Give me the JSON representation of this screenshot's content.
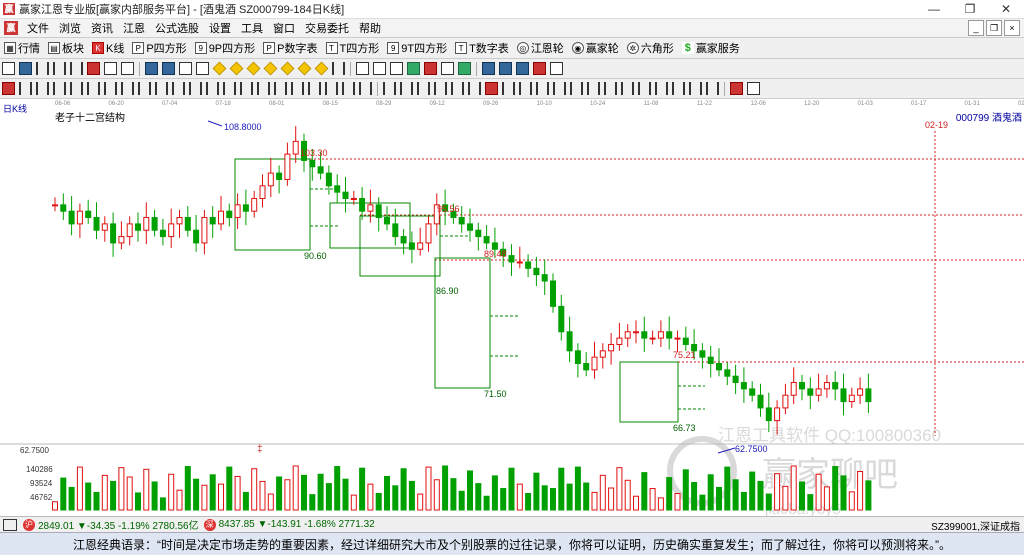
{
  "window": {
    "title": "赢家江恩专业版[赢家内部服务平台] - [酒鬼酒  SZ000799-184日K线]",
    "controls": [
      "—",
      "❐",
      "✕"
    ]
  },
  "menubar": {
    "items": [
      "文件",
      "浏览",
      "资讯",
      "江恩",
      "公式选股",
      "设置",
      "工具",
      "窗口",
      "交易委托",
      "帮助"
    ],
    "mdi_controls": [
      "_",
      "❐",
      "×"
    ]
  },
  "toolbar1": {
    "items": [
      {
        "label": "行情",
        "icon": "grid-icon"
      },
      {
        "label": "板块",
        "icon": "blocks-icon"
      },
      {
        "label": "K线",
        "icon": "candle-icon"
      },
      {
        "label": "P四方形",
        "icon": "p-square-icon"
      },
      {
        "label": "9P四方形",
        "icon": "9p-square-icon"
      },
      {
        "label": "P数字表",
        "icon": "p-table-icon"
      },
      {
        "label": "T四方形",
        "icon": "t-square-icon"
      },
      {
        "label": "9T四方形",
        "icon": "9t-square-icon"
      },
      {
        "label": "T数字表",
        "icon": "t-table-icon"
      },
      {
        "label": "江恩轮",
        "icon": "gann-wheel-icon"
      },
      {
        "label": "赢家轮",
        "icon": "winner-wheel-icon"
      },
      {
        "label": "六角形",
        "icon": "hexagon-icon"
      },
      {
        "label": "赢家服务",
        "icon": "dollar-icon"
      }
    ]
  },
  "chart": {
    "period_label": "日K线",
    "title": "老子十二宫结构",
    "stock": "000799  酒鬼酒",
    "date_axis": [
      "06-06",
      "06-20",
      "07-04",
      "07-18",
      "08-01",
      "08-15",
      "08-29",
      "09-12",
      "09-26",
      "10-10",
      "10-24",
      "11-08",
      "11-22",
      "12-06",
      "12-20",
      "01-03",
      "01-17",
      "01-31",
      "02-14",
      "02-28",
      "03-07"
    ],
    "price_labels": [
      "108.8000",
      "103.30",
      "90.60",
      "95.56",
      "86.90",
      "89.48",
      "71.50",
      "75.21",
      "66.73",
      "62.7500"
    ],
    "date_marker": "02-19",
    "volume_axis": [
      "140286",
      "93524",
      "46762"
    ],
    "top_value": "62.7500",
    "watermark": [
      "江恩工具软件  QQ:100800360",
      "赢家聊吧",
      "jiaoba.yoy5"
    ]
  },
  "chart_data": {
    "type": "candlestick",
    "title": "老子十二宫结构",
    "annotations": [
      {
        "label": "108.8000",
        "value": 108.8
      },
      {
        "label": "103.30",
        "value": 103.3
      },
      {
        "label": "90.60",
        "value": 90.6
      },
      {
        "label": "95.56",
        "value": 95.56
      },
      {
        "label": "86.90",
        "value": 86.9
      },
      {
        "label": "89.48",
        "value": 89.48
      },
      {
        "label": "71.50",
        "value": 71.5
      },
      {
        "label": "75.21",
        "value": 75.21
      },
      {
        "label": "66.73",
        "value": 66.73
      },
      {
        "label": "62.7500",
        "value": 62.75
      }
    ],
    "close": [
      98,
      97,
      95,
      97,
      96,
      94,
      95,
      92,
      93,
      95,
      94,
      96,
      94,
      93,
      95,
      96,
      94,
      92,
      96,
      95,
      97,
      96,
      98,
      97,
      99,
      101,
      103,
      102,
      106,
      108,
      105,
      104,
      103,
      101,
      100,
      99,
      99,
      97,
      98,
      96,
      95,
      93,
      92,
      91,
      92,
      95,
      98,
      97,
      96,
      95,
      94,
      93,
      92,
      91,
      90,
      89,
      89,
      88,
      87,
      86,
      82,
      78,
      75,
      73,
      72,
      74,
      75,
      76,
      77,
      78,
      78,
      77,
      77,
      78,
      77,
      77,
      76,
      75,
      74,
      73,
      72,
      71,
      70,
      69,
      68,
      66,
      64,
      66,
      68,
      70,
      69,
      68,
      69,
      70,
      69,
      67,
      68,
      69,
      67
    ],
    "volume_ylim": [
      0,
      140286
    ]
  },
  "statusbar": {
    "idx1_icon": "沪",
    "idx1": "2849.01 ▼-34.35 -1.19% 2780.56亿",
    "idx2_icon": "深",
    "idx2": "8437.85 ▼-143.91 -1.68% 2771.32",
    "right": "SZ399001,深证成指"
  },
  "quote": {
    "text": "江恩经典语录：“时间是决定市场走势的重要因素，经过详细研究大市及个别股票的过往记录，你将可以证明，历史确实重复发生；而了解过往，你将可以预测将来。”。"
  },
  "colors": {
    "up": "#e01010",
    "down": "#00a000",
    "box": "#008a00",
    "level": "#d02020"
  }
}
